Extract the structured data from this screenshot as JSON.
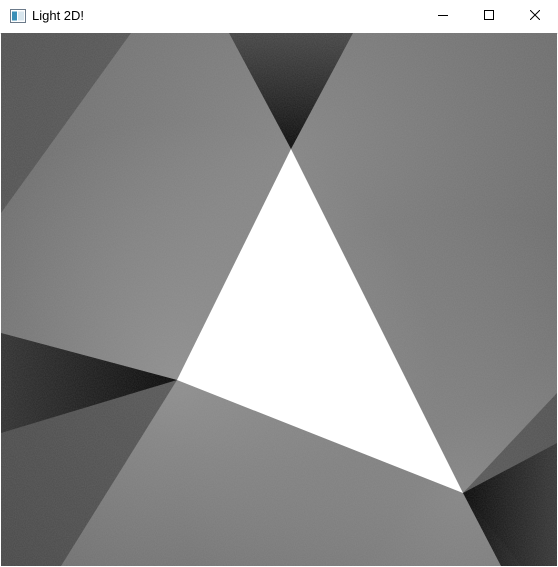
{
  "window": {
    "title": "Light 2D!",
    "app_icon": "app-window-icon",
    "controls": {
      "minimize_icon": "minimize-icon",
      "maximize_icon": "maximize-icon",
      "close_icon": "close-icon"
    }
  },
  "scene": {
    "description_icon": "rendered-light-canvas",
    "light_color": "#ffffff",
    "background_color": "#5a5a5a"
  }
}
